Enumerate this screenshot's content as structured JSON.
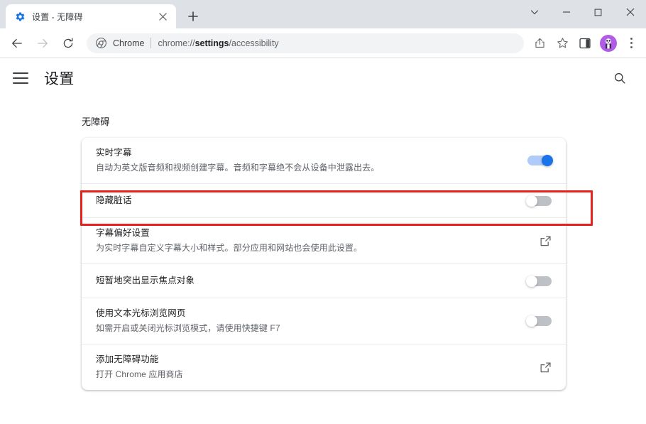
{
  "browser": {
    "tab": {
      "favicon": "settings-gear-icon",
      "title": "设置 - 无障碍",
      "close_label": "×"
    },
    "new_tab_label": "+",
    "window_controls": {
      "tab_search": "tab-search-chevron-icon",
      "minimize": "minimize-icon",
      "maximize": "maximize-icon",
      "close": "close-icon"
    },
    "toolbar": {
      "back": "back-arrow-icon",
      "forward": "forward-arrow-icon",
      "reload": "reload-icon",
      "omnibox": {
        "site_icon": "chrome-logo-icon",
        "chip": "Chrome",
        "url_prefix": "chrome://",
        "url_bold": "settings",
        "url_suffix": "/accessibility",
        "url_full": "chrome://settings/accessibility"
      },
      "share": "share-icon",
      "bookmark": "star-icon",
      "side_panel": "side-panel-icon",
      "avatar": "profile-avatar",
      "menu": "three-dot-menu-icon"
    }
  },
  "settings": {
    "menu_button": "hamburger-menu",
    "title": "设置",
    "search": "search-icon",
    "section_title": "无障碍",
    "rows": [
      {
        "name": "live-caption",
        "label": "实时字幕",
        "sub": "自动为英文版音频和视频创建字幕。音频和字幕绝不会从设备中泄露出去。",
        "control": "toggle",
        "state": "on"
      },
      {
        "name": "mask-profanity",
        "label": "隐藏脏话",
        "sub": "",
        "control": "toggle",
        "state": "off",
        "highlighted": true
      },
      {
        "name": "caption-preferences",
        "label": "字幕偏好设置",
        "sub": "为实时字幕自定义字幕大小和样式。部分应用和网站也会使用此设置。",
        "control": "external-link"
      },
      {
        "name": "focus-highlight",
        "label": "短暂地突出显示焦点对象",
        "sub": "",
        "control": "toggle",
        "state": "off"
      },
      {
        "name": "caret-browsing",
        "label": "使用文本光标浏览网页",
        "sub": "如需开启或关闭光标浏览模式，请使用快捷键 F7",
        "control": "toggle",
        "state": "off"
      },
      {
        "name": "add-accessibility-features",
        "label": "添加无障碍功能",
        "sub": "打开 Chrome 应用商店",
        "control": "external-link"
      }
    ]
  },
  "colors": {
    "accent": "#1a73e8",
    "toggle_on_track": "#aecbfa",
    "toggle_off_track": "#bdc1c6",
    "highlight_border": "#e8211c",
    "titlebar": "#dee1e6",
    "avatar_bg": "#b05ce6"
  }
}
